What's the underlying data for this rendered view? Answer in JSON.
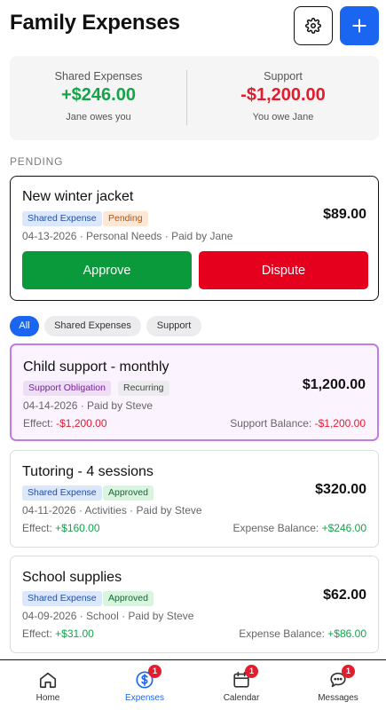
{
  "header": {
    "title": "Family Expenses"
  },
  "summary": {
    "shared": {
      "label": "Shared Expenses",
      "value": "+$246.00",
      "note": "Jane owes you"
    },
    "support": {
      "label": "Support",
      "value": "-$1,200.00",
      "note": "You owe Jane"
    }
  },
  "pending": {
    "section_label": "PENDING",
    "item": {
      "title": "New winter jacket",
      "badges": [
        "Shared Expense",
        "Pending"
      ],
      "meta": "04-13-2026 · Personal Needs · Paid by Jane",
      "amount": "$89.00",
      "approve_label": "Approve",
      "dispute_label": "Dispute"
    }
  },
  "filters": {
    "items": [
      "All",
      "Shared Expenses",
      "Support"
    ],
    "active": "All"
  },
  "expenses": [
    {
      "title": "Child support - monthly",
      "badges": [
        "Support Obligation",
        "Recurring"
      ],
      "meta": "04-14-2026 · Paid by Steve",
      "amount": "$1,200.00",
      "effect_label": "Effect:",
      "effect_value": "-$1,200.00",
      "balance_label": "Support Balance:",
      "balance_value": "-$1,200.00"
    },
    {
      "title": "Tutoring - 4 sessions",
      "badges": [
        "Shared Expense",
        "Approved"
      ],
      "meta": "04-11-2026 · Activities · Paid by Steve",
      "amount": "$320.00",
      "effect_label": "Effect:",
      "effect_value": "+$160.00",
      "balance_label": "Expense Balance:",
      "balance_value": "+$246.00"
    },
    {
      "title": "School supplies",
      "badges": [
        "Shared Expense",
        "Approved"
      ],
      "meta": "04-09-2026 · School · Paid by Steve",
      "amount": "$62.00",
      "effect_label": "Effect:",
      "effect_value": "+$31.00",
      "balance_label": "Expense Balance:",
      "balance_value": "+$86.00"
    }
  ],
  "tabbar": {
    "active": "Expenses",
    "tabs": [
      {
        "label": "Home",
        "icon": "home-icon",
        "badge": ""
      },
      {
        "label": "Expenses",
        "icon": "dollar-icon",
        "badge": "1"
      },
      {
        "label": "Calendar",
        "icon": "calendar-icon",
        "badge": "1"
      },
      {
        "label": "Messages",
        "icon": "chat-icon",
        "badge": "1"
      }
    ]
  },
  "colors": {
    "accent": "#1a66f0",
    "positive": "#16a34a",
    "negative": "#e11d2e",
    "approve": "#0a9a3c",
    "dispute": "#e5001e",
    "support_highlight": "#c27be6"
  }
}
